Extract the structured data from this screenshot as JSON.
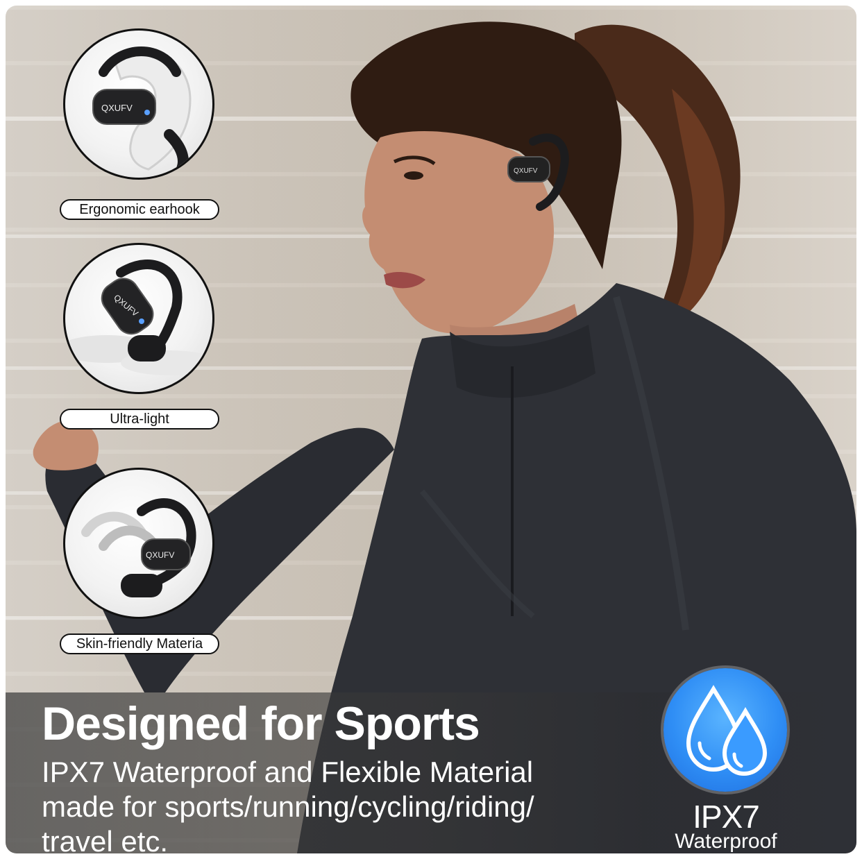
{
  "features": [
    {
      "label": "Ergonomic earhook",
      "icon": "ear-with-earhook-icon"
    },
    {
      "label": "Ultra-light",
      "icon": "floating-earbud-icon"
    },
    {
      "label": "Skin-friendly Materia",
      "icon": "flexible-earhook-icon"
    }
  ],
  "brand_mark": "QXUFV",
  "headline": "Designed for Sports",
  "description_lines": [
    "IPX7 Waterproof and Flexible Material",
    "made for sports/running/cycling/riding/",
    "travel etc."
  ],
  "badge": {
    "title": "IPX7",
    "subtitle": "Waterproof",
    "icon": "water-drops-icon",
    "color": "#2f8ef5"
  },
  "colors": {
    "shirt": "#2e3036",
    "hair": "#3a2418",
    "skin": "#c99276",
    "background": "#d2cac0"
  }
}
